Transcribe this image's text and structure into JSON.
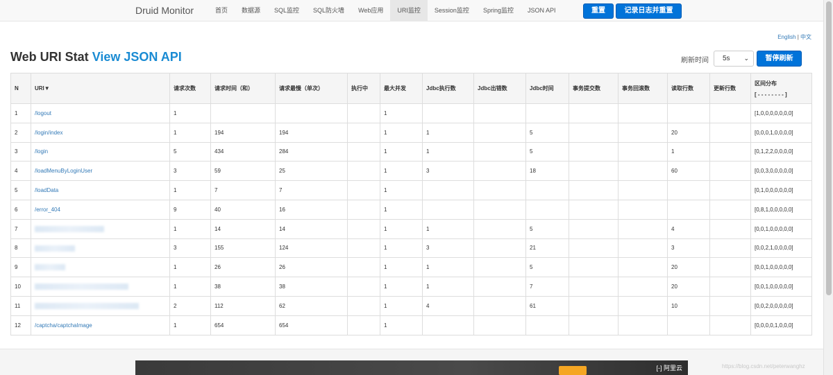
{
  "navbar": {
    "brand": "Druid Monitor",
    "items": [
      "首页",
      "数据源",
      "SQL监控",
      "SQL防火墙",
      "Web应用",
      "URI监控",
      "Session监控",
      "Spring监控",
      "JSON API"
    ],
    "active_index": 5,
    "reset_label": "重置",
    "log_reset_label": "记录日志并重置"
  },
  "lang": {
    "english": "English",
    "sep": "|",
    "chinese": "中文"
  },
  "page": {
    "title": "Web URI Stat",
    "title_link": "View JSON API"
  },
  "refresh": {
    "label": "刷新时间",
    "value": "5s",
    "pause_label": "暂停刷新"
  },
  "table": {
    "headers": [
      "N",
      "URI▼",
      "请求次数",
      "请求时间（和）",
      "请求最慢（单次）",
      "执行中",
      "最大并发",
      "Jdbc执行数",
      "Jdbc出错数",
      "Jdbc时间",
      "事务提交数",
      "事务回滚数",
      "读取行数",
      "更新行数"
    ],
    "dist_header": {
      "line1": "区间分布",
      "line2": "[ - - - - - - - - ]"
    },
    "rows": [
      {
        "n": "1",
        "uri": "/logout",
        "count": "1",
        "time": "",
        "slowest": "",
        "running": "",
        "concurrent": "1",
        "jdbc_exec": "",
        "jdbc_err": "",
        "jdbc_time": "",
        "tx_commit": "",
        "tx_rollback": "",
        "rows_read": "",
        "rows_update": "",
        "dist": "[1,0,0,0,0,0,0,0]"
      },
      {
        "n": "2",
        "uri": "/login/index",
        "count": "1",
        "time": "194",
        "slowest": "194",
        "running": "",
        "concurrent": "1",
        "jdbc_exec": "1",
        "jdbc_err": "",
        "jdbc_time": "5",
        "tx_commit": "",
        "tx_rollback": "",
        "rows_read": "20",
        "rows_update": "",
        "dist": "[0,0,0,1,0,0,0,0]"
      },
      {
        "n": "3",
        "uri": "/login",
        "count": "5",
        "time": "434",
        "slowest": "284",
        "running": "",
        "concurrent": "1",
        "jdbc_exec": "1",
        "jdbc_err": "",
        "jdbc_time": "5",
        "tx_commit": "",
        "tx_rollback": "",
        "rows_read": "1",
        "rows_update": "",
        "dist": "[0,1,2,2,0,0,0,0]"
      },
      {
        "n": "4",
        "uri": "/loadMenuByLoginUser",
        "count": "3",
        "time": "59",
        "slowest": "25",
        "running": "",
        "concurrent": "1",
        "jdbc_exec": "3",
        "jdbc_err": "",
        "jdbc_time": "18",
        "tx_commit": "",
        "tx_rollback": "",
        "rows_read": "60",
        "rows_update": "",
        "dist": "[0,0,3,0,0,0,0,0]"
      },
      {
        "n": "5",
        "uri": "/loadData",
        "count": "1",
        "time": "7",
        "slowest": "7",
        "running": "",
        "concurrent": "1",
        "jdbc_exec": "",
        "jdbc_err": "",
        "jdbc_time": "",
        "tx_commit": "",
        "tx_rollback": "",
        "rows_read": "",
        "rows_update": "",
        "dist": "[0,1,0,0,0,0,0,0]"
      },
      {
        "n": "6",
        "uri": "/error_404",
        "count": "9",
        "time": "40",
        "slowest": "16",
        "running": "",
        "concurrent": "1",
        "jdbc_exec": "",
        "jdbc_err": "",
        "jdbc_time": "",
        "tx_commit": "",
        "tx_rollback": "",
        "rows_read": "",
        "rows_update": "",
        "dist": "[0,8,1,0,0,0,0,0]"
      },
      {
        "n": "7",
        "uri": "",
        "count": "1",
        "time": "14",
        "slowest": "14",
        "running": "",
        "concurrent": "1",
        "jdbc_exec": "1",
        "jdbc_err": "",
        "jdbc_time": "5",
        "tx_commit": "",
        "tx_rollback": "",
        "rows_read": "4",
        "rows_update": "",
        "dist": "[0,0,1,0,0,0,0,0]"
      },
      {
        "n": "8",
        "uri": "",
        "count": "3",
        "time": "155",
        "slowest": "124",
        "running": "",
        "concurrent": "1",
        "jdbc_exec": "3",
        "jdbc_err": "",
        "jdbc_time": "21",
        "tx_commit": "",
        "tx_rollback": "",
        "rows_read": "3",
        "rows_update": "",
        "dist": "[0,0,2,1,0,0,0,0]"
      },
      {
        "n": "9",
        "uri": "",
        "count": "1",
        "time": "26",
        "slowest": "26",
        "running": "",
        "concurrent": "1",
        "jdbc_exec": "1",
        "jdbc_err": "",
        "jdbc_time": "5",
        "tx_commit": "",
        "tx_rollback": "",
        "rows_read": "20",
        "rows_update": "",
        "dist": "[0,0,1,0,0,0,0,0]"
      },
      {
        "n": "10",
        "uri": "",
        "count": "1",
        "time": "38",
        "slowest": "38",
        "running": "",
        "concurrent": "1",
        "jdbc_exec": "1",
        "jdbc_err": "",
        "jdbc_time": "7",
        "tx_commit": "",
        "tx_rollback": "",
        "rows_read": "20",
        "rows_update": "",
        "dist": "[0,0,1,0,0,0,0,0]"
      },
      {
        "n": "11",
        "uri": "",
        "count": "2",
        "time": "112",
        "slowest": "62",
        "running": "",
        "concurrent": "1",
        "jdbc_exec": "4",
        "jdbc_err": "",
        "jdbc_time": "61",
        "tx_commit": "",
        "tx_rollback": "",
        "rows_read": "10",
        "rows_update": "",
        "dist": "[0,0,2,0,0,0,0,0]"
      },
      {
        "n": "12",
        "uri": "/captcha/captchaImage",
        "count": "1",
        "time": "654",
        "slowest": "654",
        "running": "",
        "concurrent": "1",
        "jdbc_exec": "",
        "jdbc_err": "",
        "jdbc_time": "",
        "tx_commit": "",
        "tx_rollback": "",
        "rows_read": "",
        "rows_update": "",
        "dist": "[0,0,0,0,1,0,0,0]"
      }
    ]
  },
  "banner": {
    "logo": "[-] 阿里云"
  },
  "watermark": "https://blog.csdn.net/peterwanghz",
  "colors": {
    "primary": "#0073d9",
    "link": "#337ab7",
    "title_link": "#1a8bd3"
  }
}
